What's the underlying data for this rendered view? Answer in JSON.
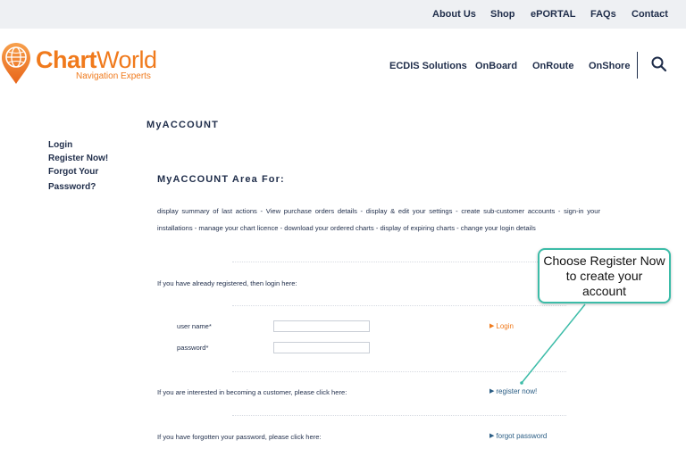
{
  "topnav": {
    "items": [
      "About Us",
      "Shop",
      "ePORTAL",
      "FAQs",
      "Contact"
    ]
  },
  "brand": {
    "name_bold": "Chart",
    "name_light": "World",
    "tagline": "Navigation Experts",
    "color": "#f07a1c"
  },
  "mainnav": {
    "items": [
      "ECDIS Solutions",
      "OnBoard",
      "OnRoute",
      "OnShore"
    ],
    "search_icon": "search-icon"
  },
  "page": {
    "title": "MyACCOUNT"
  },
  "sidenav": {
    "items": [
      "Login",
      "Register Now!",
      "Forgot Your",
      "Password?"
    ]
  },
  "area": {
    "title": "MyACCOUNT Area For:",
    "description": "display summary of last actions - View purchase orders details - display & edit your settings - create sub-customer accounts - sign-in your installations - manage your chart licence - download your ordered charts - display of expiring charts - change your login details"
  },
  "login": {
    "intro": "If you have already registered, then login here:",
    "username_label": "user name*",
    "password_label": "password*",
    "username_value": "",
    "password_value": "",
    "button": "Login"
  },
  "register": {
    "intro": "If you are interested in becoming a customer, please click here:",
    "link": "register now!"
  },
  "forgot": {
    "intro": "If you have forgotten your password, please click here:",
    "link": "forgot password"
  },
  "callout": {
    "text": "Choose Register Now to create your account",
    "border_color": "#3cbca8"
  },
  "colors": {
    "navy": "#1f2d4a",
    "orange": "#f07a1c",
    "link_blue": "#2a5d84"
  }
}
